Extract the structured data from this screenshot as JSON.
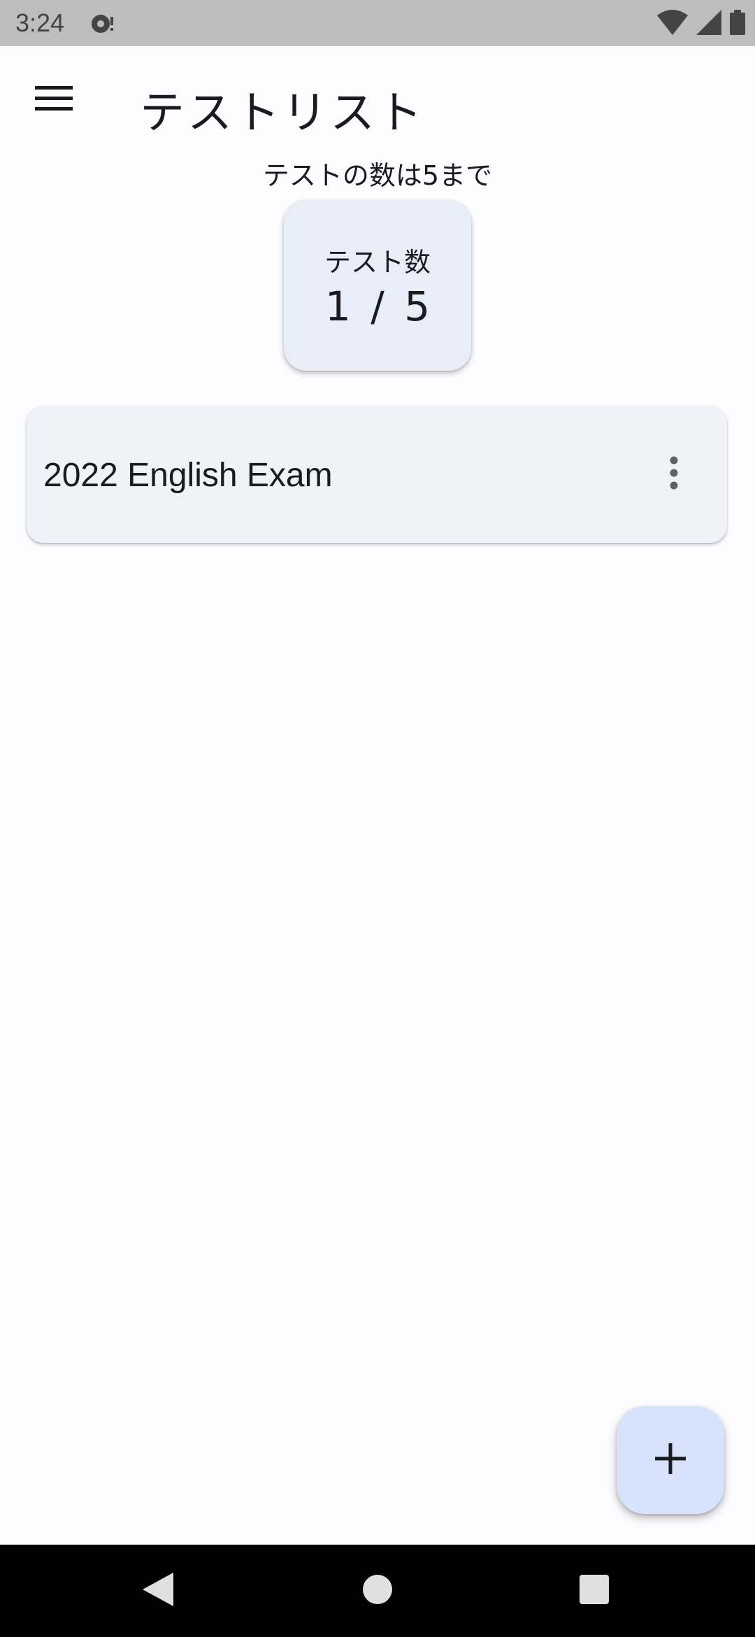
{
  "status_bar": {
    "time": "3:24",
    "icons": [
      "notification-icon",
      "wifi-icon",
      "signal-icon",
      "battery-icon"
    ]
  },
  "app_bar": {
    "title": "テストリスト",
    "menu_icon": "hamburger-menu-icon"
  },
  "limit_notice": "テストの数は5まで",
  "test_count": {
    "label": "テスト数",
    "value": "1 / 5"
  },
  "tests": [
    {
      "name": "2022 English Exam",
      "menu_icon": "more-vert-icon"
    }
  ],
  "fab": {
    "icon": "add-icon"
  },
  "nav": {
    "icons": [
      "back-icon",
      "home-icon",
      "recents-icon"
    ]
  },
  "colors": {
    "background": "#fdfcff",
    "card": "#eff2f9",
    "count_card": "#e8eef8",
    "fab": "#d6e3fb"
  }
}
